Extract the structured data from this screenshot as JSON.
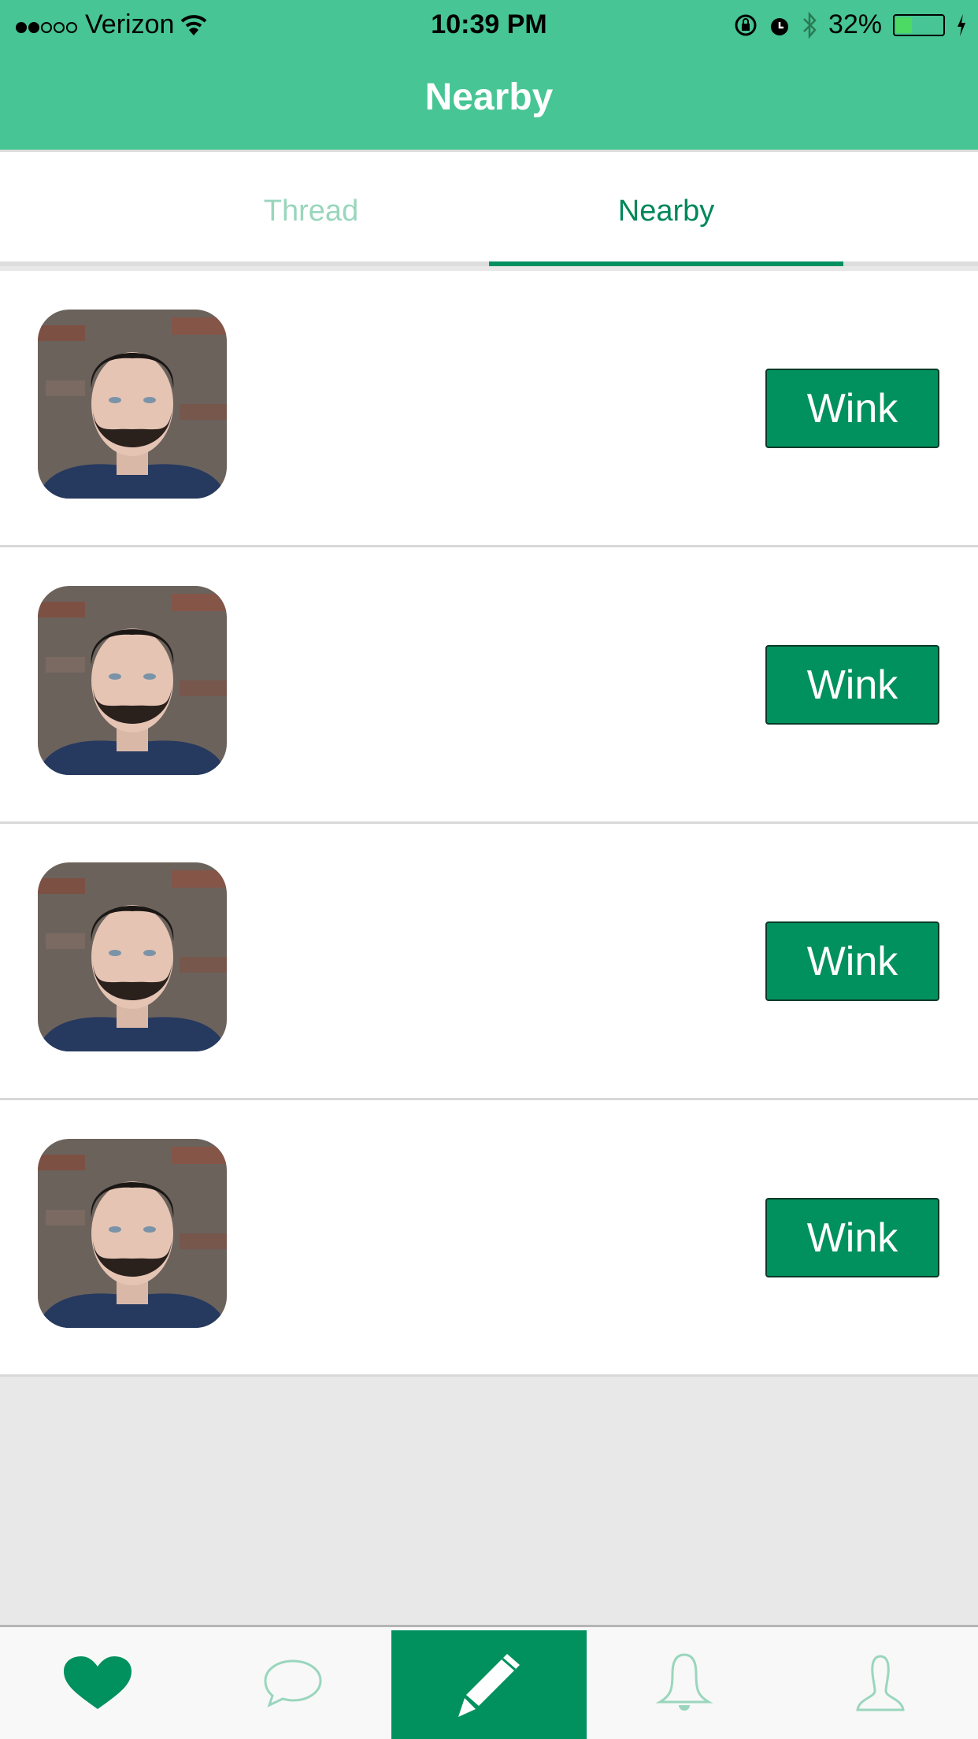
{
  "status_bar": {
    "carrier": "Verizon",
    "signal_bars": 2,
    "signal_total": 5,
    "time": "10:39 PM",
    "battery_percent": "32%",
    "battery_level": 0.32
  },
  "header": {
    "title": "Nearby"
  },
  "tabs": [
    {
      "label": "Thread",
      "active": false
    },
    {
      "label": "Nearby",
      "active": true
    }
  ],
  "nearby": [
    {
      "action": "Wink"
    },
    {
      "action": "Wink"
    },
    {
      "action": "Wink"
    },
    {
      "action": "Wink"
    }
  ],
  "tab_bar": [
    {
      "icon": "heart-icon"
    },
    {
      "icon": "chat-bubble-icon"
    },
    {
      "icon": "pencil-icon",
      "active": true
    },
    {
      "icon": "bell-icon"
    },
    {
      "icon": "profile-icon"
    }
  ],
  "colors": {
    "header": "#47c594",
    "accent": "#00915f",
    "inactive": "#9ad6bd"
  }
}
